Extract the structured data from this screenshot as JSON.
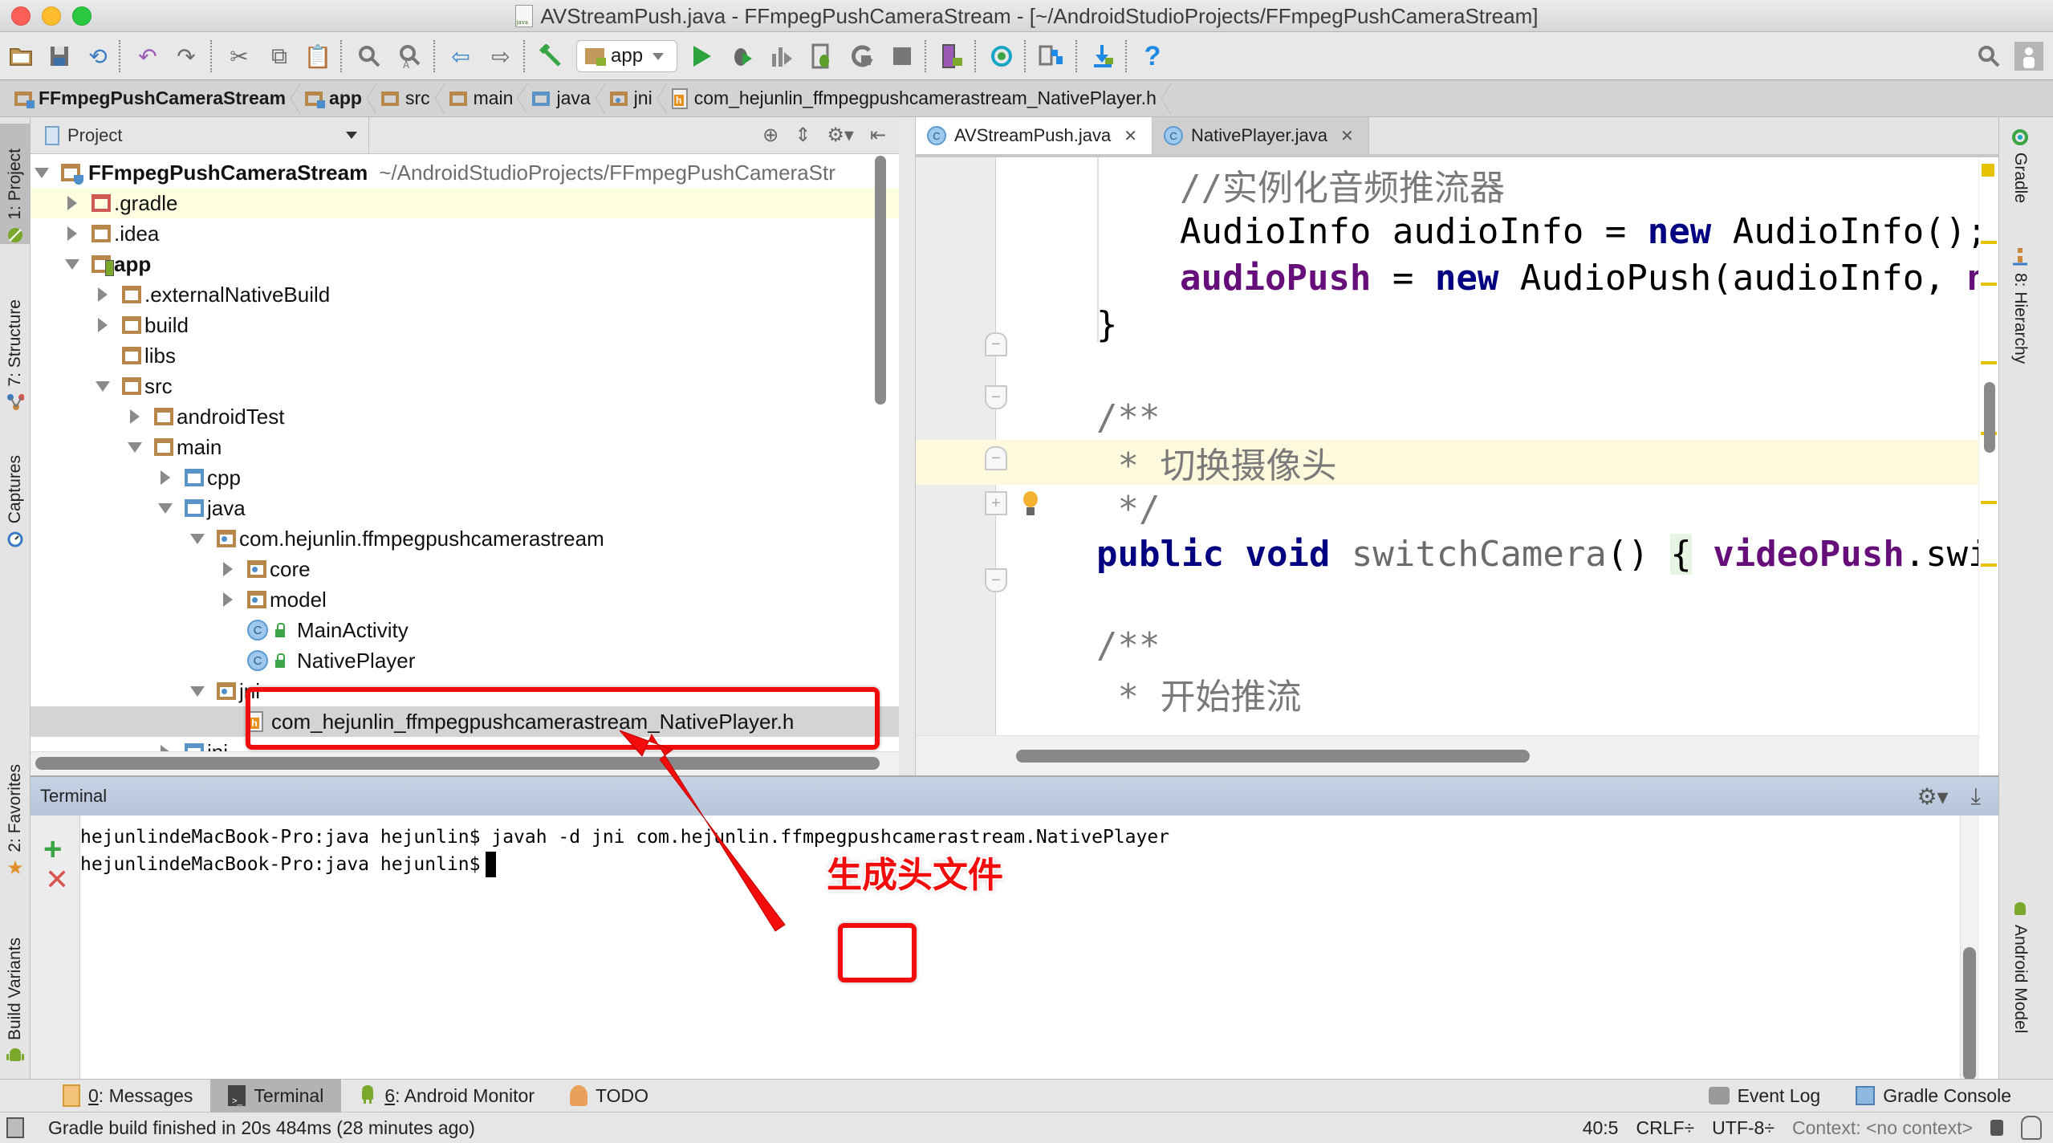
{
  "window": {
    "title": "AVStreamPush.java - FFmpegPushCameraStream - [~/AndroidStudioProjects/FFmpegPushCameraStream]"
  },
  "toolbar": {
    "run_config": "app",
    "icons": [
      "open-folder-icon",
      "save-icon",
      "sync-icon",
      "undo-icon",
      "redo-icon",
      "cut-icon",
      "copy-icon",
      "paste-icon",
      "find-icon",
      "replace-icon",
      "back-icon",
      "forward-icon",
      "make-project-icon",
      "run-icon",
      "debug-icon",
      "profile-icon",
      "attach-debugger-icon",
      "apply-changes-icon",
      "stop-icon",
      "avd-manager-icon",
      "sync-gradle-icon",
      "project-structure-icon",
      "sdk-manager-icon",
      "help-icon",
      "search-everywhere-icon",
      "user-icon"
    ]
  },
  "breadcrumb": [
    {
      "label": "FFmpegPushCameraStream",
      "icon": "project-folder-icon"
    },
    {
      "label": "app",
      "icon": "module-folder-icon"
    },
    {
      "label": "src",
      "icon": "folder-icon"
    },
    {
      "label": "main",
      "icon": "folder-icon"
    },
    {
      "label": "java",
      "icon": "source-folder-icon"
    },
    {
      "label": "jni",
      "icon": "package-folder-icon"
    },
    {
      "label": "com_hejunlin_ffmpegpushcamerastream_NativePlayer.h",
      "icon": "header-file-icon"
    }
  ],
  "left_strip": {
    "tabs": [
      {
        "label": "1: Project",
        "active": true
      },
      {
        "label": "7: Structure",
        "active": false
      },
      {
        "label": "Captures",
        "active": false
      },
      {
        "label": "2: Favorites",
        "active": false
      },
      {
        "label": "Build Variants",
        "active": false
      }
    ]
  },
  "right_strip": {
    "tabs": [
      {
        "label": "Gradle"
      },
      {
        "label": "8: Hierarchy"
      },
      {
        "label": "Android Model"
      }
    ]
  },
  "project_panel": {
    "view_selector": "Project",
    "root_path": "~/AndroidStudioProjects/FFmpegPushCameraStr",
    "tree": [
      {
        "label": "FFmpegPushCameraStream",
        "depth": 0,
        "state": "expanded",
        "kind": "project",
        "bold": true
      },
      {
        "label": ".gradle",
        "depth": 1,
        "state": "collapsed",
        "kind": "folder-red"
      },
      {
        "label": ".idea",
        "depth": 1,
        "state": "collapsed",
        "kind": "folder"
      },
      {
        "label": "app",
        "depth": 1,
        "state": "expanded",
        "kind": "module",
        "bold": true
      },
      {
        "label": ".externalNativeBuild",
        "depth": 2,
        "state": "collapsed",
        "kind": "folder"
      },
      {
        "label": "build",
        "depth": 2,
        "state": "collapsed",
        "kind": "folder"
      },
      {
        "label": "libs",
        "depth": 2,
        "state": "leaf",
        "kind": "folder"
      },
      {
        "label": "src",
        "depth": 2,
        "state": "expanded",
        "kind": "folder"
      },
      {
        "label": "androidTest",
        "depth": 3,
        "state": "collapsed",
        "kind": "folder"
      },
      {
        "label": "main",
        "depth": 3,
        "state": "expanded",
        "kind": "folder"
      },
      {
        "label": "cpp",
        "depth": 4,
        "state": "collapsed",
        "kind": "folder-blue"
      },
      {
        "label": "java",
        "depth": 4,
        "state": "expanded",
        "kind": "folder-blue"
      },
      {
        "label": "com.hejunlin.ffmpegpushcamerastream",
        "depth": 5,
        "state": "expanded",
        "kind": "package"
      },
      {
        "label": "core",
        "depth": 6,
        "state": "collapsed",
        "kind": "package"
      },
      {
        "label": "model",
        "depth": 6,
        "state": "collapsed",
        "kind": "package"
      },
      {
        "label": "MainActivity",
        "depth": 6,
        "state": "leaf",
        "kind": "class"
      },
      {
        "label": "NativePlayer",
        "depth": 6,
        "state": "leaf",
        "kind": "class"
      },
      {
        "label": "jni",
        "depth": 5,
        "state": "expanded",
        "kind": "package"
      },
      {
        "label": "com_hejunlin_ffmpegpushcamerastream_NativePlayer.h",
        "depth": 6,
        "state": "leaf",
        "kind": "header",
        "selected": true
      },
      {
        "label": "jni",
        "depth": 4,
        "state": "collapsed",
        "kind": "folder-blue"
      }
    ]
  },
  "editor": {
    "tabs": [
      {
        "label": "AVStreamPush.java",
        "active": true
      },
      {
        "label": "NativePlayer.java",
        "active": false
      }
    ],
    "lines": [
      {
        "tokens": [
          {
            "t": "//实例化音频推流器",
            "c": "comment"
          }
        ],
        "indent": 1
      },
      {
        "tokens": [
          {
            "t": "AudioInfo audioInfo = ",
            "c": "plain"
          },
          {
            "t": "new",
            "c": "kw"
          },
          {
            "t": " AudioInfo();",
            "c": "plain"
          }
        ],
        "indent": 1
      },
      {
        "tokens": [
          {
            "t": "audioPush",
            "c": "field"
          },
          {
            "t": " = ",
            "c": "plain"
          },
          {
            "t": "new",
            "c": "kw"
          },
          {
            "t": " AudioPush(audioInfo, ",
            "c": "plain"
          },
          {
            "t": "nat:",
            "c": "field"
          }
        ],
        "indent": 1
      },
      {
        "tokens": [
          {
            "t": "}",
            "c": "plain"
          }
        ],
        "indent": 0
      },
      {
        "tokens": [],
        "indent": 0
      },
      {
        "tokens": [
          {
            "t": "/**",
            "c": "comment"
          }
        ],
        "indent": 0
      },
      {
        "tokens": [
          {
            "t": " * 切换摄像头",
            "c": "comment"
          }
        ],
        "indent": 0,
        "caret_line": true
      },
      {
        "tokens": [
          {
            "t": " */",
            "c": "comment"
          }
        ],
        "indent": 0
      },
      {
        "tokens": [
          {
            "t": "public",
            "c": "kw"
          },
          {
            "t": " ",
            "c": "plain"
          },
          {
            "t": "void",
            "c": "kw"
          },
          {
            "t": " switchCamera",
            "c": "method"
          },
          {
            "t": "() ",
            "c": "plain"
          },
          {
            "t": "{",
            "c": "brace"
          },
          {
            "t": " ",
            "c": "plain"
          },
          {
            "t": "videoPush",
            "c": "field"
          },
          {
            "t": ".switcl",
            "c": "plain"
          }
        ],
        "indent": 0
      },
      {
        "tokens": [],
        "indent": 0
      },
      {
        "tokens": [
          {
            "t": "/**",
            "c": "comment"
          }
        ],
        "indent": 0
      },
      {
        "tokens": [
          {
            "t": " * 开始推流",
            "c": "comment"
          }
        ],
        "indent": 0
      }
    ]
  },
  "terminal": {
    "title": "Terminal",
    "lines": [
      "hejunlindeMacBook-Pro:java hejunlin$ javah -d jni com.hejunlin.ffmpegpushcamerastream.NativePlayer",
      "hejunlindeMacBook-Pro:java hejunlin$"
    ]
  },
  "tool_tabs": {
    "left": [
      {
        "label_prefix": "0",
        "label_rest": ": Messages",
        "icon": "messages-icon",
        "active": false
      },
      {
        "label_prefix": "",
        "label_rest": "Terminal",
        "icon": "terminal-icon",
        "active": true
      },
      {
        "label_prefix": "6",
        "label_rest": ": Android Monitor",
        "icon": "android-icon",
        "active": false
      },
      {
        "label_prefix": "",
        "label_rest": "TODO",
        "icon": "todo-icon",
        "active": false
      }
    ],
    "right": [
      {
        "label": "Event Log",
        "icon": "event-log-icon"
      },
      {
        "label": "Gradle Console",
        "icon": "gradle-console-icon"
      }
    ]
  },
  "status_bar": {
    "message": "Gradle build finished in 20s 484ms (28 minutes ago)",
    "position": "40:5",
    "line_separator": "CRLF÷",
    "encoding": "UTF-8÷",
    "context": "Context: <no context>"
  },
  "annotations": {
    "callout_text": "生成头文件",
    "accent_color": "#f20c0c"
  }
}
